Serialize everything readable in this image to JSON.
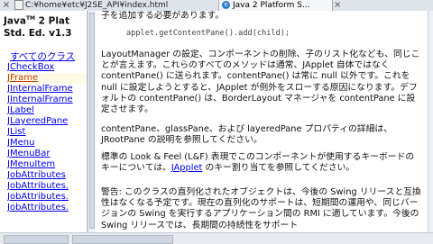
{
  "tabs": {
    "file_path": "C:¥home¥etc¥J2SE_API¥index.html",
    "active_tab_label": "Java 2 Platform S...",
    "browser_icon_label": "e"
  },
  "left_frame": {
    "title_lines": [
      "Java",
      "2 Plat",
      "Std. Ed. v1.3"
    ],
    "all_classes_link": "すべてのクラス",
    "classes": [
      "JCheckBox",
      "JFrame",
      "JInternalFrame",
      "JInternalFrame",
      "JLabel",
      "JLayeredPane",
      "JList",
      "JMenu",
      "JMenuBar",
      "JMenuItem",
      "JobAttributes",
      "JobAttributes.",
      "JobAttributes.",
      "JobAttributes."
    ]
  },
  "content": {
    "top_line": "子を追加する必要があります。",
    "code_line": "applet.getContentPane().add(child);",
    "para1": "LayoutManager の設定、コンポーネントの削除、子のリスト化なども、同じことが言えます。これらのすべてのメソッドは通常、JApplet 自体ではなく contentPane() に送られます。contentPane() は常に null 以外です。これを null に設定しようとすると、JApplet が例外をスローする原因になります。デフォルトの contentPane() は、BorderLayout マネージャを contentPane に設定させます。",
    "para2": "contentPane、glassPane、および layeredPane プロパティの詳細は、JRootPane の説明を参照してください。",
    "para3_pre": "標準の Look & Feel (L&F) 表現でこのコンポーネントが使用するキーボードのキーについては、",
    "para3_link": "JApplet",
    "para3_post": " のキー割り当てを参照してください。",
    "para4": "警告: このクラスの直列化されたオブジェクトは、今後の Swing リリースと互換性はなくなる予定です。現在の直列化のサポートは、短期間の運用や、同じバージョンの Swing を実行するアプリケーション間の RMI に適しています。今後の Swing リリースでは、長期間の持続性をサポート"
  }
}
